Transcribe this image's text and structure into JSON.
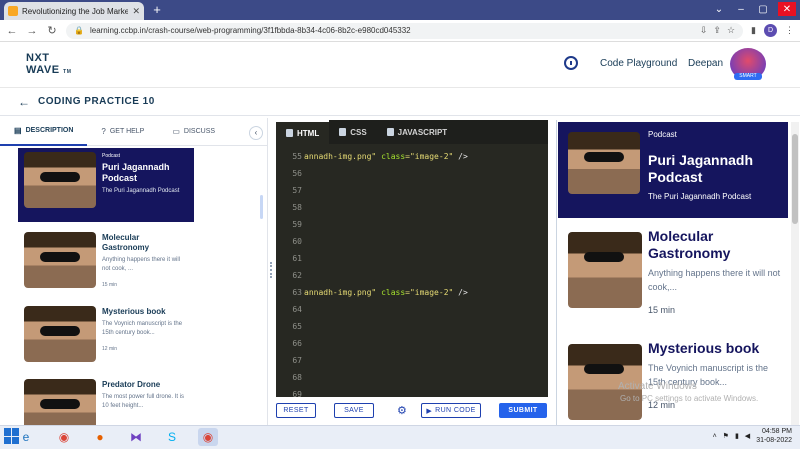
{
  "browser": {
    "tab_title": "Revolutionizing the Job Market |",
    "url": "learning.ccbp.in/crash-course/web-programming/3f1fbbda-8b34-4c06-8b2c-e980cd045332",
    "profile_initial": "D"
  },
  "header": {
    "logo_line1": "NXT",
    "logo_line2": "WAVE",
    "logo_tm": "TM",
    "code_playground": "Code Playground",
    "user_name": "Deepan",
    "badge": "SMART"
  },
  "practice": {
    "title": "CODING PRACTICE 10"
  },
  "left_tabs": [
    {
      "label": "DESCRIPTION",
      "icon": "book-icon"
    },
    {
      "label": "GET HELP",
      "icon": "help-icon"
    },
    {
      "label": "DISCUSS",
      "icon": "chat-icon"
    }
  ],
  "left_cards": {
    "featured": {
      "category": "Podcast",
      "title": "Puri Jagannadh Podcast",
      "desc": "The Puri Jagannadh Podcast"
    },
    "items": [
      {
        "title": "Molecular Gastronomy",
        "desc": "Anything happens there it will not cook, ...",
        "meta": "15 min"
      },
      {
        "title": "Mysterious book",
        "desc": "The Voynich manuscript is the 15th century book...",
        "meta": "12 min"
      },
      {
        "title": "Predator Drone",
        "desc": "The most power full drone. It is 10 feet height...",
        "meta": ""
      }
    ]
  },
  "editor": {
    "tabs": [
      "HTML",
      "CSS",
      "JAVASCRIPT"
    ],
    "line_numbers": [
      "55",
      "56",
      "57",
      "58",
      "59",
      "60",
      "61",
      "62",
      "63",
      "64",
      "65",
      "66",
      "67",
      "68",
      "69"
    ],
    "code_line_55": {
      "a": "annadh-img.png\"",
      "b": " class",
      "c": "=\"image-2\"",
      "d": " />"
    },
    "code_line_63": {
      "a": "annadh-img.png\"",
      "b": " class",
      "c": "=\"image-2\"",
      "d": " />"
    }
  },
  "buttons": {
    "reset": "RESET",
    "save": "SAVE",
    "run_code": "RUN CODE",
    "submit": "SUBMIT"
  },
  "preview": {
    "featured": {
      "category": "Podcast",
      "title": "Puri Jagannadh Podcast",
      "desc": "The Puri Jagannadh Podcast"
    },
    "items": [
      {
        "title": "Molecular Gastronomy",
        "desc": "Anything happens there it will not cook,...",
        "meta": "15 min"
      },
      {
        "title": "Mysterious book",
        "desc": "The Voynich manuscript is the 15th century book...",
        "meta": "12 min"
      }
    ],
    "watermark_line1": "Activate Windows",
    "watermark_line2": "Go to PC settings to activate Windows."
  },
  "taskbar": {
    "time": "04:58 PM",
    "date": "31-08-2022"
  },
  "colors": {
    "brand_navy": "#15155e",
    "accent_blue": "#2563eb",
    "editor_bg": "#272822"
  }
}
